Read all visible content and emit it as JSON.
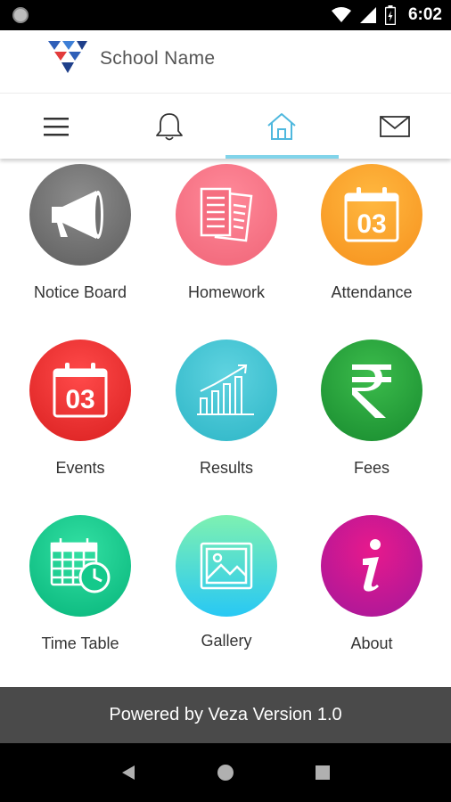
{
  "status_bar": {
    "time": "6:02"
  },
  "header": {
    "school_name": "School Name"
  },
  "nav_tabs": [
    {
      "name": "menu-icon",
      "active": false
    },
    {
      "name": "bell-icon",
      "active": false
    },
    {
      "name": "home-icon",
      "active": true
    },
    {
      "name": "mail-icon",
      "active": false
    }
  ],
  "tiles": [
    {
      "label": "Notice Board",
      "icon": "megaphone-icon",
      "color": "#6f6f6f"
    },
    {
      "label": "Homework",
      "icon": "documents-icon",
      "color": "#f56e80"
    },
    {
      "label": "Attendance",
      "icon": "calendar-icon",
      "color": "#f8a12a",
      "icon_text": "03"
    },
    {
      "label": "Events",
      "icon": "calendar-icon",
      "color": "#e52a2a",
      "icon_text": "03"
    },
    {
      "label": "Results",
      "icon": "bar-chart-icon",
      "color": "#3ec2d2"
    },
    {
      "label": "Fees",
      "icon": "rupee-icon",
      "color": "#23a23a"
    },
    {
      "label": "Time Table",
      "icon": "timetable-icon",
      "color": "#14c98b"
    },
    {
      "label": "Gallery",
      "icon": "image-icon",
      "color": "#4fdcd0"
    },
    {
      "label": "About",
      "icon": "info-icon",
      "color": "#c21893"
    }
  ],
  "footer": {
    "text": "Powered by Veza Version 1.0"
  }
}
